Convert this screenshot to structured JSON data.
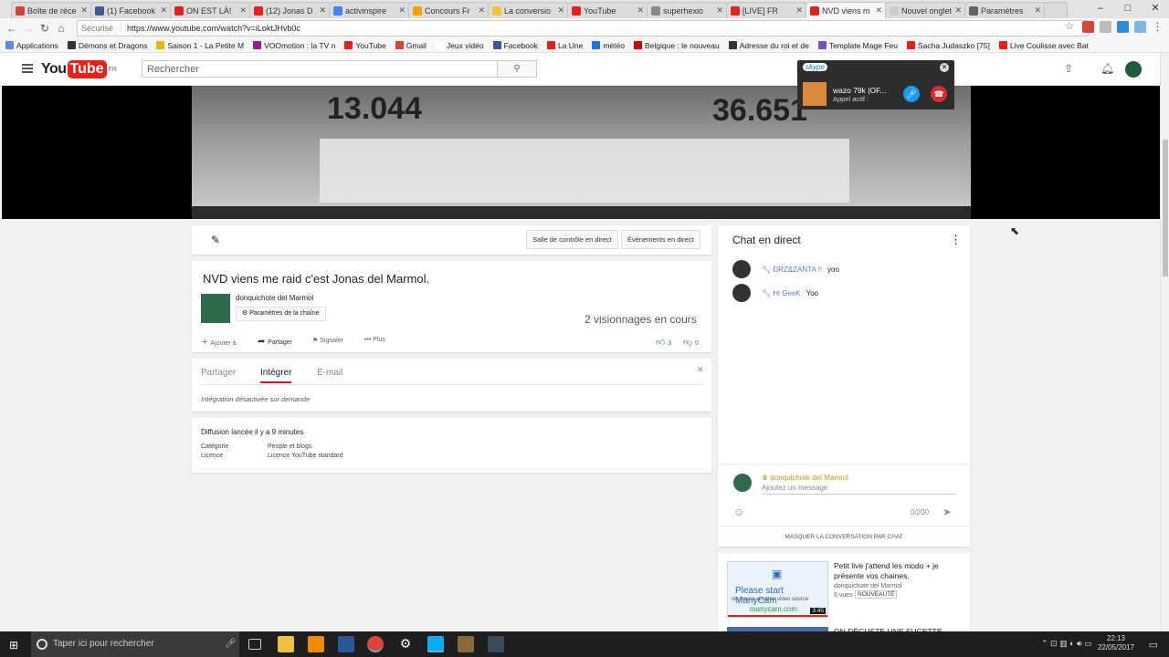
{
  "browser": {
    "tabs": [
      {
        "label": "Boîte de réce",
        "color": "#d44638",
        "active": false
      },
      {
        "label": "(1) Facebook",
        "color": "#3b5998",
        "active": false
      },
      {
        "label": "ON EST LÀ!",
        "color": "#e62117",
        "active": false
      },
      {
        "label": "(12) Jonas D",
        "color": "#e62117",
        "active": false
      },
      {
        "label": "activinspire",
        "color": "#4285f4",
        "active": false
      },
      {
        "label": "Concours Fr",
        "color": "#f4a300",
        "active": false
      },
      {
        "label": "La conversio",
        "color": "#f4c430",
        "active": false
      },
      {
        "label": "YouTube",
        "color": "#e62117",
        "active": false
      },
      {
        "label": "superhexio",
        "color": "#888888",
        "active": false
      },
      {
        "label": "[LIVE] FR",
        "color": "#e62117",
        "active": false
      },
      {
        "label": "NVD viens m",
        "color": "#e62117",
        "active": true
      },
      {
        "label": "Nouvel onglet",
        "color": "#cccccc",
        "active": false
      },
      {
        "label": "Paramètres",
        "color": "#666666",
        "active": false
      }
    ],
    "secure_label": "Sécurisé",
    "url": "https://www.youtube.com/watch?v=iLoktJHvb0c",
    "bookmarks": [
      {
        "label": "Applications",
        "color": "#5a8de0"
      },
      {
        "label": "Démons et Dragons",
        "color": "#333333"
      },
      {
        "label": "Saison 1 - La Petite M",
        "color": "#e6b800"
      },
      {
        "label": "VOOmotion : la TV n",
        "color": "#9c1c8c"
      },
      {
        "label": "YouTube",
        "color": "#e62117"
      },
      {
        "label": "Gmail",
        "color": "#d44638"
      },
      {
        "label": "Jeux vidéo",
        "color": "#ffffff"
      },
      {
        "label": "Facebook",
        "color": "#3b5998"
      },
      {
        "label": "La Une",
        "color": "#e62117"
      },
      {
        "label": "météo",
        "color": "#1a73e8"
      },
      {
        "label": "Belgique : le nouveau",
        "color": "#cc0000"
      },
      {
        "label": "Adresse du roi et de",
        "color": "#333333"
      },
      {
        "label": "Template Mage Feu",
        "color": "#7a4fc0"
      },
      {
        "label": "Sacha Judaszko [75]",
        "color": "#e62117"
      },
      {
        "label": "Live Coulisse avec Bat",
        "color": "#e62117"
      }
    ]
  },
  "youtube": {
    "logo_you": "You",
    "logo_tube": "Tube",
    "logo_country": "FR",
    "search_placeholder": "Rechercher",
    "video": {
      "left_number": "13.044",
      "right_number": "36.651"
    },
    "toolbar": {
      "control_room": "Salle de contrôle en direct",
      "events": "Événements en direct"
    },
    "title": "NVD viens me raid c'est Jonas del Marmol.",
    "channel_name": "donquichote del Marmol",
    "channel_settings": "Paramètres de la chaîne",
    "views": "2 visionnages en cours",
    "actions": {
      "add": "Ajouter à",
      "share": "Partager",
      "report": "Signaler",
      "more": "Plus",
      "likes": "3",
      "dislikes": "0"
    },
    "share_tabs": {
      "share": "Partager",
      "embed": "Intégrer",
      "email": "E-mail"
    },
    "embed_note": "Intégration désactivée sur demande",
    "stream_started": "Diffusion lancée il y a 9 minutes",
    "category_label": "Catégorie",
    "category_value": "People et blogs",
    "license_label": "Licence",
    "license_value": "Licence YouTube standard"
  },
  "chat": {
    "header": "Chat en direct",
    "messages": [
      {
        "author": "DRZ&ZANTA !!",
        "text": "yoo"
      },
      {
        "author": "Hi GeeK",
        "text": "Yoo"
      }
    ],
    "me": "donquichote del Marmol",
    "input_placeholder": "Ajoutez un message",
    "counter": "0/200",
    "hide": "Masquer la conversation par chat"
  },
  "related": [
    {
      "title": "Petit live j'attend les modo + je présente vos chaines.",
      "channel": "donquichote del Marmol",
      "views": "6 vues",
      "badge": "NOUVEAUTÉ",
      "duration": "3:45",
      "thumb_line1": "Please start ManyCam",
      "thumb_line2": "or choose another video source",
      "thumb_line3": "manycam.com"
    },
    {
      "title": "ON DÉGUSTE UNE SUCETTE"
    }
  ],
  "skype": {
    "brand": "skype",
    "caller": "wazo 79k |OF...",
    "status": "Appel actif :"
  },
  "taskbar": {
    "search_placeholder": "Taper ici pour rechercher",
    "time": "22:13",
    "date": "22/05/2017"
  }
}
